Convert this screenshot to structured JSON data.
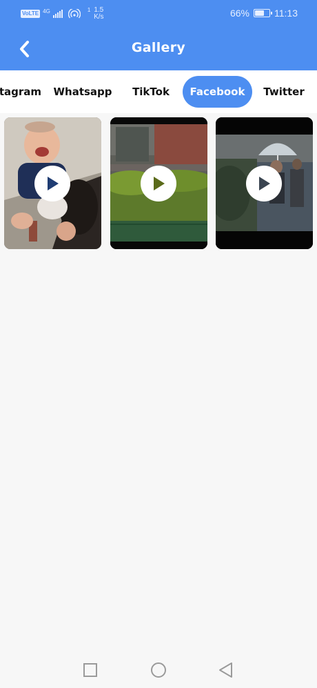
{
  "status_bar": {
    "volte": "VoLTE",
    "network_type": "4G",
    "data_rate_prefix": "1",
    "data_rate_value": "1.5",
    "data_rate_unit": "K/s",
    "battery_percent": "66%",
    "battery_level": 0.66,
    "time": "11:13"
  },
  "app_bar": {
    "title": "Gallery",
    "back_icon": "chevron-left-icon"
  },
  "tabs": [
    {
      "label": "Instagram",
      "active": false
    },
    {
      "label": "Whatsapp",
      "active": false
    },
    {
      "label": "TikTok",
      "active": false
    },
    {
      "label": "Facebook",
      "active": true
    },
    {
      "label": "Twitter",
      "active": false
    }
  ],
  "videos": [
    {
      "thumbnail": "laughing-baby",
      "icon": "play-icon"
    },
    {
      "thumbnail": "garden-hedge",
      "icon": "play-icon"
    },
    {
      "thumbnail": "rain-umbrella",
      "icon": "play-icon"
    }
  ],
  "nav_bar": {
    "recents_icon": "square-icon",
    "home_icon": "circle-icon",
    "back_icon": "triangle-back-icon"
  },
  "colors": {
    "primary": "#4d8ef1",
    "background": "#f7f7f7",
    "tab_text": "#111111"
  }
}
